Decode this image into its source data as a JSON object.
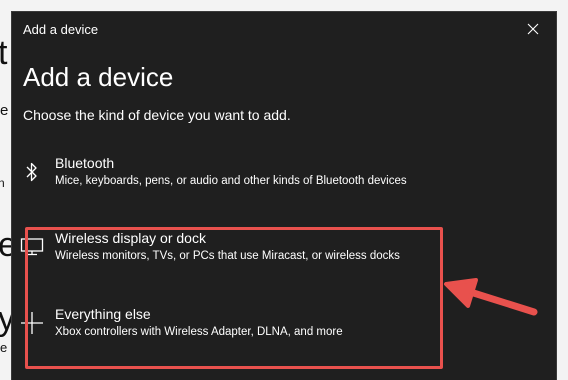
{
  "background_window": {
    "fragments": [
      "t",
      "e",
      "n",
      "e",
      "y",
      "e"
    ]
  },
  "dialog": {
    "title_bar": "Add a device",
    "heading": "Add a device",
    "subheading": "Choose the kind of device you want to add.",
    "options": [
      {
        "icon": "bluetooth-icon",
        "title": "Bluetooth",
        "description": "Mice, keyboards, pens, or audio and other kinds of Bluetooth devices"
      },
      {
        "icon": "monitor-icon",
        "title": "Wireless display or dock",
        "description": "Wireless monitors, TVs, or PCs that use Miracast, or wireless docks"
      },
      {
        "icon": "plus-icon",
        "title": "Everything else",
        "description": "Xbox controllers with Wireless Adapter, DLNA, and more"
      }
    ]
  },
  "annotation": {
    "highlight_color": "#e8514d",
    "arrow_color": "#e8514d"
  },
  "colors": {
    "dialog_bg": "#1f1f1f",
    "text": "#ffffff",
    "background_window": "#f3f3f3"
  }
}
